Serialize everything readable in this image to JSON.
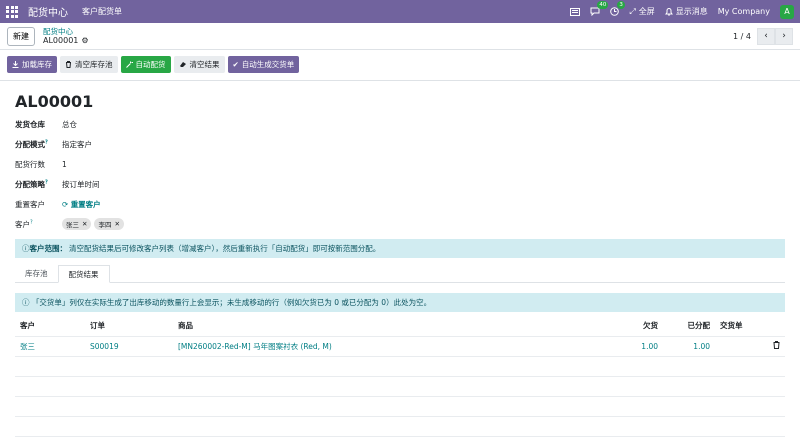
{
  "topbar": {
    "app_title": "配货中心",
    "menu": "客户配货单",
    "messages_badge": "40",
    "activity_badge": "3",
    "fullscreen": "全屏",
    "notify": "显示消息",
    "company": "My Company",
    "avatar": "A"
  },
  "control_panel": {
    "new_button": "新建",
    "breadcrumb_parent": "配货中心",
    "breadcrumb_current": "AL00001",
    "pager": "1 / 4"
  },
  "actions": {
    "load": "加载库存",
    "clear_pool": "清空库存池",
    "auto_allocate": "自动配货",
    "clear_result": "清空结果",
    "auto_generate": "自动生成交货单"
  },
  "record": {
    "title": "AL00001",
    "fields": {
      "warehouse_label": "发货仓库",
      "warehouse_value": "总仓",
      "mode_label": "分配模式",
      "mode_value": "指定客户",
      "lines_label": "配货行数",
      "lines_value": "1",
      "strategy_label": "分配策略",
      "strategy_value": "按订单时间",
      "reset_label": "重置客户",
      "reset_value": "重置客户",
      "customers_label": "客户"
    },
    "customer_tags": [
      "张三",
      "李四"
    ],
    "alert_bold": "客户范围：",
    "alert_text": "清空配货结果后可修改客户列表（增减客户），然后重新执行「自动配货」即可按新范围分配。",
    "tabs": [
      "库存池",
      "配货结果"
    ],
    "alert2": "「交货单」列仅在实际生成了出库移动的数量行上会显示；未生成移动的行（例如欠货已为 0 或已分配为 0）此处为空。",
    "table": {
      "headers": [
        "客户",
        "订单",
        "商品",
        "欠货",
        "已分配",
        "交货单"
      ],
      "rows": [
        {
          "customer": "张三",
          "order": "S00019",
          "product": "[MN260002-Red-M] 马年图案衬衣 (Red, M)",
          "owed": "1.00",
          "allocated": "1.00",
          "delivery": ""
        }
      ]
    }
  }
}
